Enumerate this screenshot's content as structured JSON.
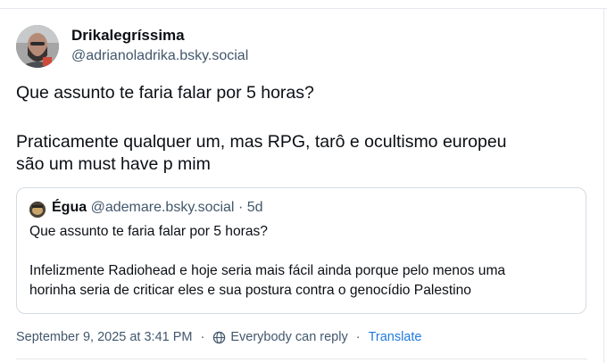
{
  "post": {
    "author": {
      "display_name": "Drikalegríssima",
      "handle": "@adrianoladrika.bsky.social",
      "avatar_icon": "avatar-photo"
    },
    "text_lines": [
      "Que assunto te faria falar por 5 horas?",
      "Praticamente qualquer um, mas RPG, tarô e ocultismo europeu",
      "são um must have p mim"
    ],
    "quote": {
      "author_name": "Égua",
      "author_handle": "@ademare.bsky.social",
      "separator": "·",
      "age": "5d",
      "text_lines": [
        "Que assunto te faria falar por 5 horas?",
        "Infelizmente Radiohead e hoje seria mais fácil ainda porque pelo menos uma",
        "horinha seria de criticar eles e sua postura contra o genocídio Palestino"
      ]
    },
    "meta": {
      "timestamp": "September 9, 2025 at 3:41 PM",
      "separator": "·",
      "reply_setting": "Everybody can reply",
      "reply_icon": "globe-icon",
      "translate_label": "Translate"
    }
  },
  "colors": {
    "text": "#0b0f14",
    "muted": "#42576c",
    "link": "#1f7ae0",
    "border": "#d4dbe2"
  }
}
